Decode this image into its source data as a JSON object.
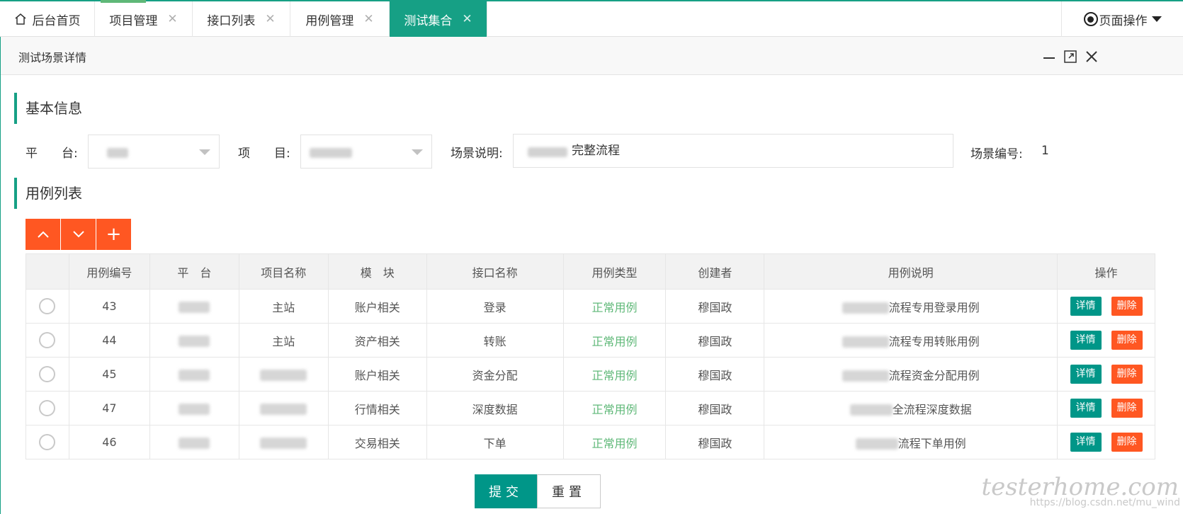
{
  "tabs": [
    {
      "label": "后台首页",
      "closable": false,
      "active": false
    },
    {
      "label": "项目管理",
      "closable": true,
      "active": false
    },
    {
      "label": "接口列表",
      "closable": true,
      "active": false
    },
    {
      "label": "用例管理",
      "closable": true,
      "active": false
    },
    {
      "label": "测试集合",
      "closable": true,
      "active": true
    }
  ],
  "page_ops_label": "页面操作",
  "panel_title": "测试场景详情",
  "basic_section_title": "基本信息",
  "form": {
    "platform_label": "平　　台:",
    "project_label": "项　　目:",
    "scene_desc_label": "场景说明:",
    "scene_desc_value": "完整流程",
    "scene_no_label": "场景编号:",
    "scene_no_value": "1"
  },
  "case_section_title": "用例列表",
  "toolbar": {
    "up": "︿",
    "down": "﹀",
    "add": "+"
  },
  "table": {
    "headers": [
      "",
      "用例编号",
      "平　台",
      "项目名称",
      "模　块",
      "接口名称",
      "用例类型",
      "创建者",
      "用例说明",
      "操作"
    ],
    "rows": [
      {
        "id": "43",
        "project": "主站",
        "module": "账户相关",
        "api": "登录",
        "type": "正常用例",
        "creator": "穆国政",
        "desc": "流程专用登录用例",
        "project_blur": false
      },
      {
        "id": "44",
        "project": "主站",
        "module": "资产相关",
        "api": "转账",
        "type": "正常用例",
        "creator": "穆国政",
        "desc": "流程专用转账用例",
        "project_blur": false
      },
      {
        "id": "45",
        "project": "",
        "module": "账户相关",
        "api": "资金分配",
        "type": "正常用例",
        "creator": "穆国政",
        "desc": "流程资金分配用例",
        "project_blur": true
      },
      {
        "id": "47",
        "project": "",
        "module": "行情相关",
        "api": "深度数据",
        "type": "正常用例",
        "creator": "穆国政",
        "desc": "全流程深度数据",
        "project_blur": true
      },
      {
        "id": "46",
        "project": "",
        "module": "交易相关",
        "api": "下单",
        "type": "正常用例",
        "creator": "穆国政",
        "desc": "流程下单用例",
        "project_blur": true
      }
    ],
    "detail_label": "详情",
    "delete_label": "删除"
  },
  "buttons": {
    "submit": "提交",
    "reset": "重置"
  },
  "watermark": {
    "logo": "testerhome.com",
    "url": "https://blog.csdn.net/mu_wind"
  },
  "colors": {
    "primary": "#16a085",
    "warm": "#ff5722",
    "type_green": "#5fb878"
  }
}
